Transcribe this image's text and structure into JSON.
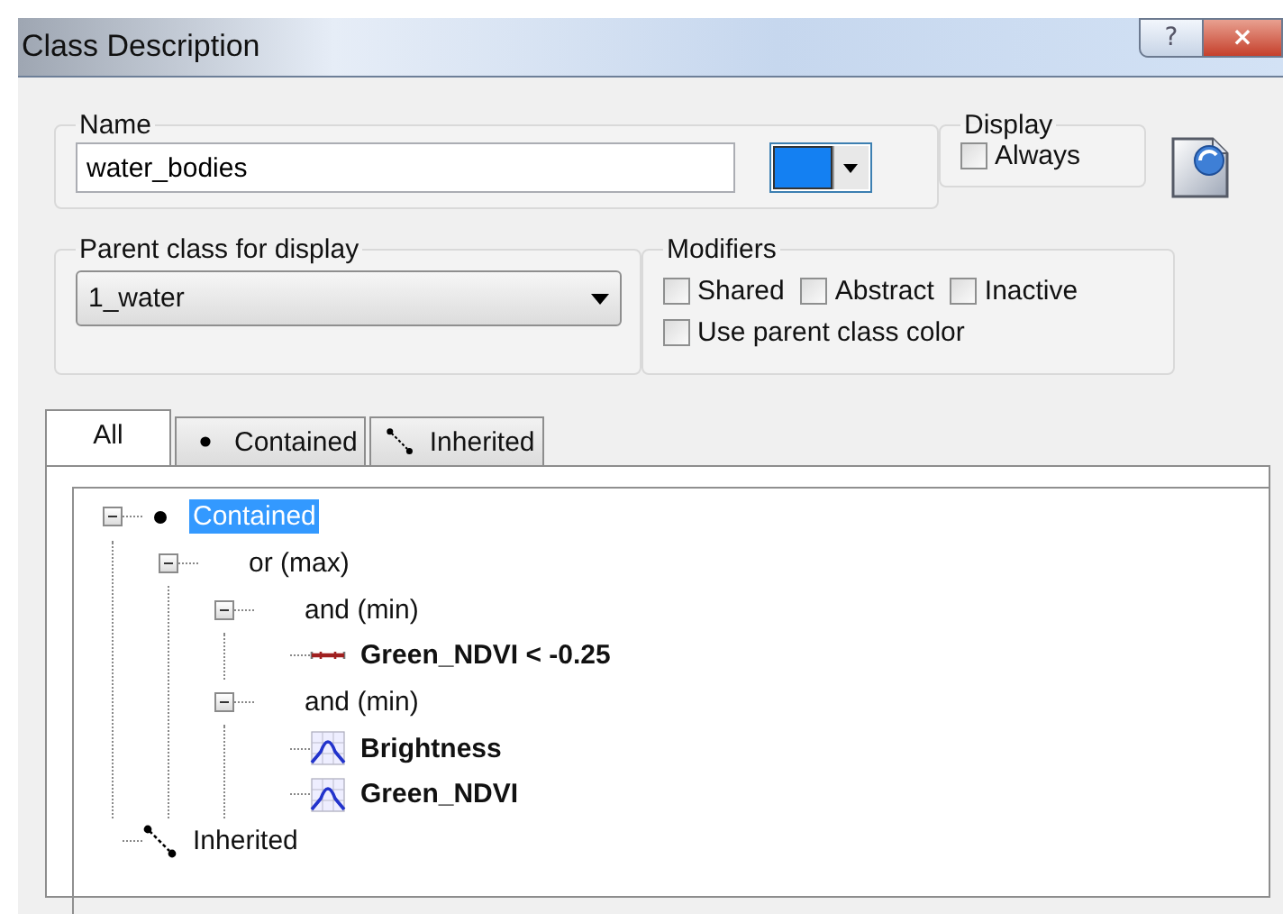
{
  "window": {
    "title": "Class Description",
    "buttons": [
      {
        "kind": "help",
        "label": "?"
      },
      {
        "kind": "close",
        "label": "×"
      }
    ]
  },
  "name_group": {
    "legend": "Name",
    "value": "water_bodies",
    "color": "#1480f2"
  },
  "display_group": {
    "legend": "Display",
    "checkbox": {
      "label": "Always",
      "checked": false
    }
  },
  "parent_group": {
    "legend": "Parent class for display",
    "value": "1_water"
  },
  "modifiers_group": {
    "legend": "Modifiers",
    "checkboxes": [
      {
        "label": "Shared",
        "checked": false
      },
      {
        "label": "Abstract",
        "checked": false
      },
      {
        "label": "Inactive",
        "checked": false
      },
      {
        "label": "Use parent class color",
        "checked": false
      }
    ]
  },
  "tabs": [
    {
      "kind": "all",
      "label": "All",
      "selected": true
    },
    {
      "kind": "contained",
      "label": "Contained",
      "selected": false
    },
    {
      "kind": "inherited",
      "label": "Inherited",
      "selected": false
    }
  ],
  "tree": [
    {
      "kind": "contained",
      "label": "Contained",
      "selected": true,
      "expanded": true,
      "children": [
        {
          "kind": "operator",
          "label": "or (max)",
          "selected": false,
          "expanded": true,
          "children": [
            {
              "kind": "operator",
              "label": "and (min)",
              "selected": false,
              "expanded": true,
              "children": [
                {
                  "kind": "threshold",
                  "label": "Green_NDVI < -0.25",
                  "selected": false
                }
              ]
            },
            {
              "kind": "operator",
              "label": "and (min)",
              "selected": false,
              "expanded": true,
              "children": [
                {
                  "kind": "membership",
                  "label": "Brightness",
                  "selected": false
                },
                {
                  "kind": "membership",
                  "label": "Green_NDVI",
                  "selected": false
                }
              ]
            }
          ]
        }
      ]
    },
    {
      "kind": "inherited",
      "label": "Inherited",
      "selected": false
    }
  ]
}
